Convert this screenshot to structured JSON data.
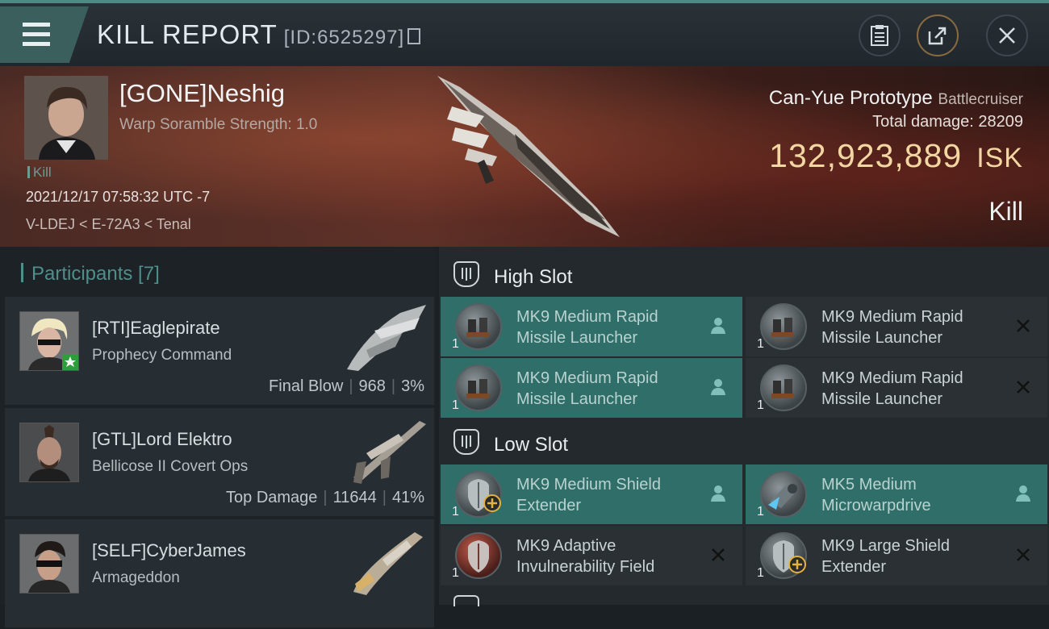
{
  "header": {
    "title": "KILL REPORT",
    "report_id": "[ID:6525297]"
  },
  "victim": {
    "name": "[GONE]Neshig",
    "scramble": "Warp Soramble Strength: 1.0",
    "tag": "Kill",
    "datetime": "2021/12/17 07:58:32 UTC -7",
    "location": "V-LDEJ < E-72A3 < Tenal",
    "ship": "Can-Yue Prototype",
    "ship_class": "Battlecruiser",
    "total_damage_label": "Total damage:",
    "total_damage": "28209",
    "isk_value": "132,923,889",
    "isk_unit": "ISK",
    "result": "Kill"
  },
  "participants": {
    "header": "Participants [7]",
    "rows": [
      {
        "name": "[RTI]Eaglepirate",
        "ship": "Prophecy Command",
        "label": "Final Blow",
        "damage": "968",
        "percent": "3%"
      },
      {
        "name": "[GTL]Lord Elektro",
        "ship": "Bellicose II Covert Ops",
        "label": "Top Damage",
        "damage": "11644",
        "percent": "41%"
      },
      {
        "name": "[SELF]CyberJames",
        "ship": "Armageddon"
      }
    ]
  },
  "modules": {
    "high_slot": {
      "title": "High Slot",
      "items": [
        {
          "line1": "MK9 Medium Rapid",
          "line2": "Missile Launcher",
          "qty": "1",
          "state": "fitted"
        },
        {
          "line1": "MK9 Medium Rapid",
          "line2": "Missile Launcher",
          "qty": "1",
          "state": "destroyed"
        },
        {
          "line1": "MK9 Medium Rapid",
          "line2": "Missile Launcher",
          "qty": "1",
          "state": "fitted"
        },
        {
          "line1": "MK9 Medium Rapid",
          "line2": "Missile Launcher",
          "qty": "1",
          "state": "destroyed"
        }
      ]
    },
    "low_slot": {
      "title": "Low Slot",
      "items": [
        {
          "line1": "MK9 Medium Shield",
          "line2": "Extender",
          "qty": "1",
          "state": "fitted"
        },
        {
          "line1": "MK5 Medium",
          "line2": "Microwarpdrive",
          "qty": "1",
          "state": "fitted"
        },
        {
          "line1": "MK9 Adaptive",
          "line2": "Invulnerability Field",
          "qty": "1",
          "state": "destroyed"
        },
        {
          "line1": "MK9 Large Shield",
          "line2": "Extender",
          "qty": "1",
          "state": "destroyed"
        }
      ]
    }
  },
  "colors": {
    "accent": "#4f8f8b",
    "fitted": "#2f6e69",
    "isk": "#f3d7a3"
  },
  "icons": [
    "menu-icon",
    "clipboard-icon",
    "share-icon",
    "close-icon",
    "copy-icon",
    "high-slot-icon",
    "low-slot-icon",
    "dropped-person-icon",
    "destroyed-x-icon",
    "plus-icon",
    "star-icon"
  ]
}
